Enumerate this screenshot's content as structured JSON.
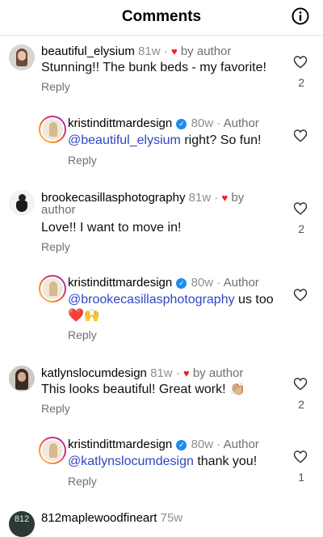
{
  "header": {
    "title": "Comments"
  },
  "comments": [
    {
      "username": "beautiful_elysium",
      "time": "81w",
      "by_author": "by author",
      "text": "Stunning!! The bunk beds - my favorite!",
      "reply_label": "Reply",
      "likes": "2"
    },
    {
      "username": "kristindittmardesign",
      "time": "80w",
      "author_label": "Author",
      "mention": "@beautiful_elysium",
      "text": " right? So fun!",
      "reply_label": "Reply"
    },
    {
      "username": "brookecasillasphotography",
      "time": "81w",
      "by_author_1": "by",
      "by_author_2": "author",
      "text": "Love!! I want to move in!",
      "reply_label": "Reply",
      "likes": "2"
    },
    {
      "username": "kristindittmardesign",
      "time": "80w",
      "author_label": "Author",
      "mention": "@brookecasillasphotography",
      "text": " us too",
      "emoji": "❤️🙌",
      "reply_label": "Reply"
    },
    {
      "username": "katlynslocumdesign",
      "time": "81w",
      "by_author": "by author",
      "text": "This looks beautiful! Great work! 👏🏼",
      "reply_label": "Reply",
      "likes": "2"
    },
    {
      "username": "kristindittmardesign",
      "time": "80w",
      "author_label": "Author",
      "mention": "@katlynslocumdesign",
      "text": " thank you!",
      "reply_label": "Reply",
      "likes": "1"
    },
    {
      "username": "812maplewoodfineart",
      "time": "75w",
      "avatar_text": "812"
    }
  ]
}
